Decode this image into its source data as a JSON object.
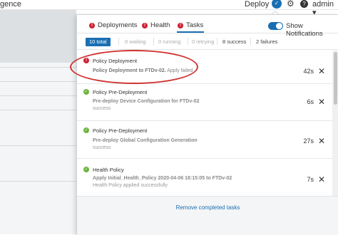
{
  "topbar": {
    "brand_partial": "gence",
    "deploy_label": "Deploy",
    "tasks_badge": "2",
    "user_label": "admin ▾",
    "gear_icon": "gear-icon",
    "help_icon": "help-icon"
  },
  "tabs": [
    {
      "label": "Deployments",
      "status": "error"
    },
    {
      "label": "Health",
      "status": "error"
    },
    {
      "label": "Tasks",
      "status": "error",
      "active": true
    }
  ],
  "notifications": {
    "label": "Show Notifications",
    "enabled": true
  },
  "filters": {
    "total": "10 total",
    "waiting": "0 waiting",
    "running": "0 running",
    "retrying": "0 retrying",
    "success": "8 success",
    "failures": "2 failures"
  },
  "tasks": [
    {
      "status": "error",
      "title": "Policy Deployment",
      "line1_bold": "Policy Deployment to FTDv-02.",
      "line1_rest": " Apply failed",
      "line2": "",
      "duration": "42s"
    },
    {
      "status": "success",
      "title": "Policy Pre-Deployment",
      "line1_bold": "Pre-deploy Device Configuration for FTDv-02",
      "line1_rest": "",
      "line2": "success",
      "duration": "6s"
    },
    {
      "status": "success",
      "title": "Policy Pre-Deployment",
      "line1_bold": "Pre-deploy Global Configuration Generation",
      "line1_rest": "",
      "line2": "success",
      "duration": "27s"
    },
    {
      "status": "success",
      "title": "Health Policy",
      "line1_bold": "Apply Initial_Health_Policy 2020-04-06 18:15:05 to FTDv-02",
      "line1_rest": "",
      "line2": "Health Policy applied successfully",
      "duration": "7s"
    }
  ],
  "footer": {
    "remove_label": "Remove completed tasks"
  },
  "colors": {
    "accent": "#1a6fb3",
    "error": "#cf2030",
    "success": "#6cb33f",
    "highlight": "#d0332f"
  }
}
